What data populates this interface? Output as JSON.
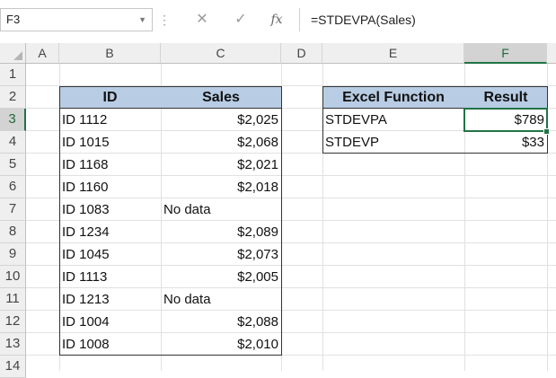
{
  "formula_bar": {
    "name_box": "F3",
    "cancel_glyph": "✕",
    "enter_glyph": "✓",
    "fx_label": "fx",
    "formula": "=STDEVPA(Sales)"
  },
  "columns": [
    "A",
    "B",
    "C",
    "D",
    "E",
    "F"
  ],
  "rows": [
    "1",
    "2",
    "3",
    "4",
    "5",
    "6",
    "7",
    "8",
    "9",
    "10",
    "11",
    "12",
    "13",
    "14"
  ],
  "data_table": {
    "headers": [
      "ID",
      "Sales"
    ],
    "rows": [
      {
        "id": "ID 1112",
        "sales": "$2,025"
      },
      {
        "id": "ID 1015",
        "sales": "$2,068"
      },
      {
        "id": "ID 1168",
        "sales": "$2,021"
      },
      {
        "id": "ID 1160",
        "sales": "$2,018"
      },
      {
        "id": "ID 1083",
        "sales": "No data"
      },
      {
        "id": "ID 1234",
        "sales": "$2,089"
      },
      {
        "id": "ID 1045",
        "sales": "$2,073"
      },
      {
        "id": "ID 1113",
        "sales": "$2,005"
      },
      {
        "id": "ID 1213",
        "sales": "No data"
      },
      {
        "id": "ID 1004",
        "sales": "$2,088"
      },
      {
        "id": "ID 1008",
        "sales": "$2,010"
      }
    ]
  },
  "result_table": {
    "headers": [
      "Excel Function",
      "Result"
    ],
    "rows": [
      {
        "function": "STDEVPA",
        "result": "$789"
      },
      {
        "function": "STDEVP",
        "result": "$33"
      }
    ]
  },
  "colors": {
    "header_fill": "#b8cce4",
    "selection_green": "#217346"
  }
}
